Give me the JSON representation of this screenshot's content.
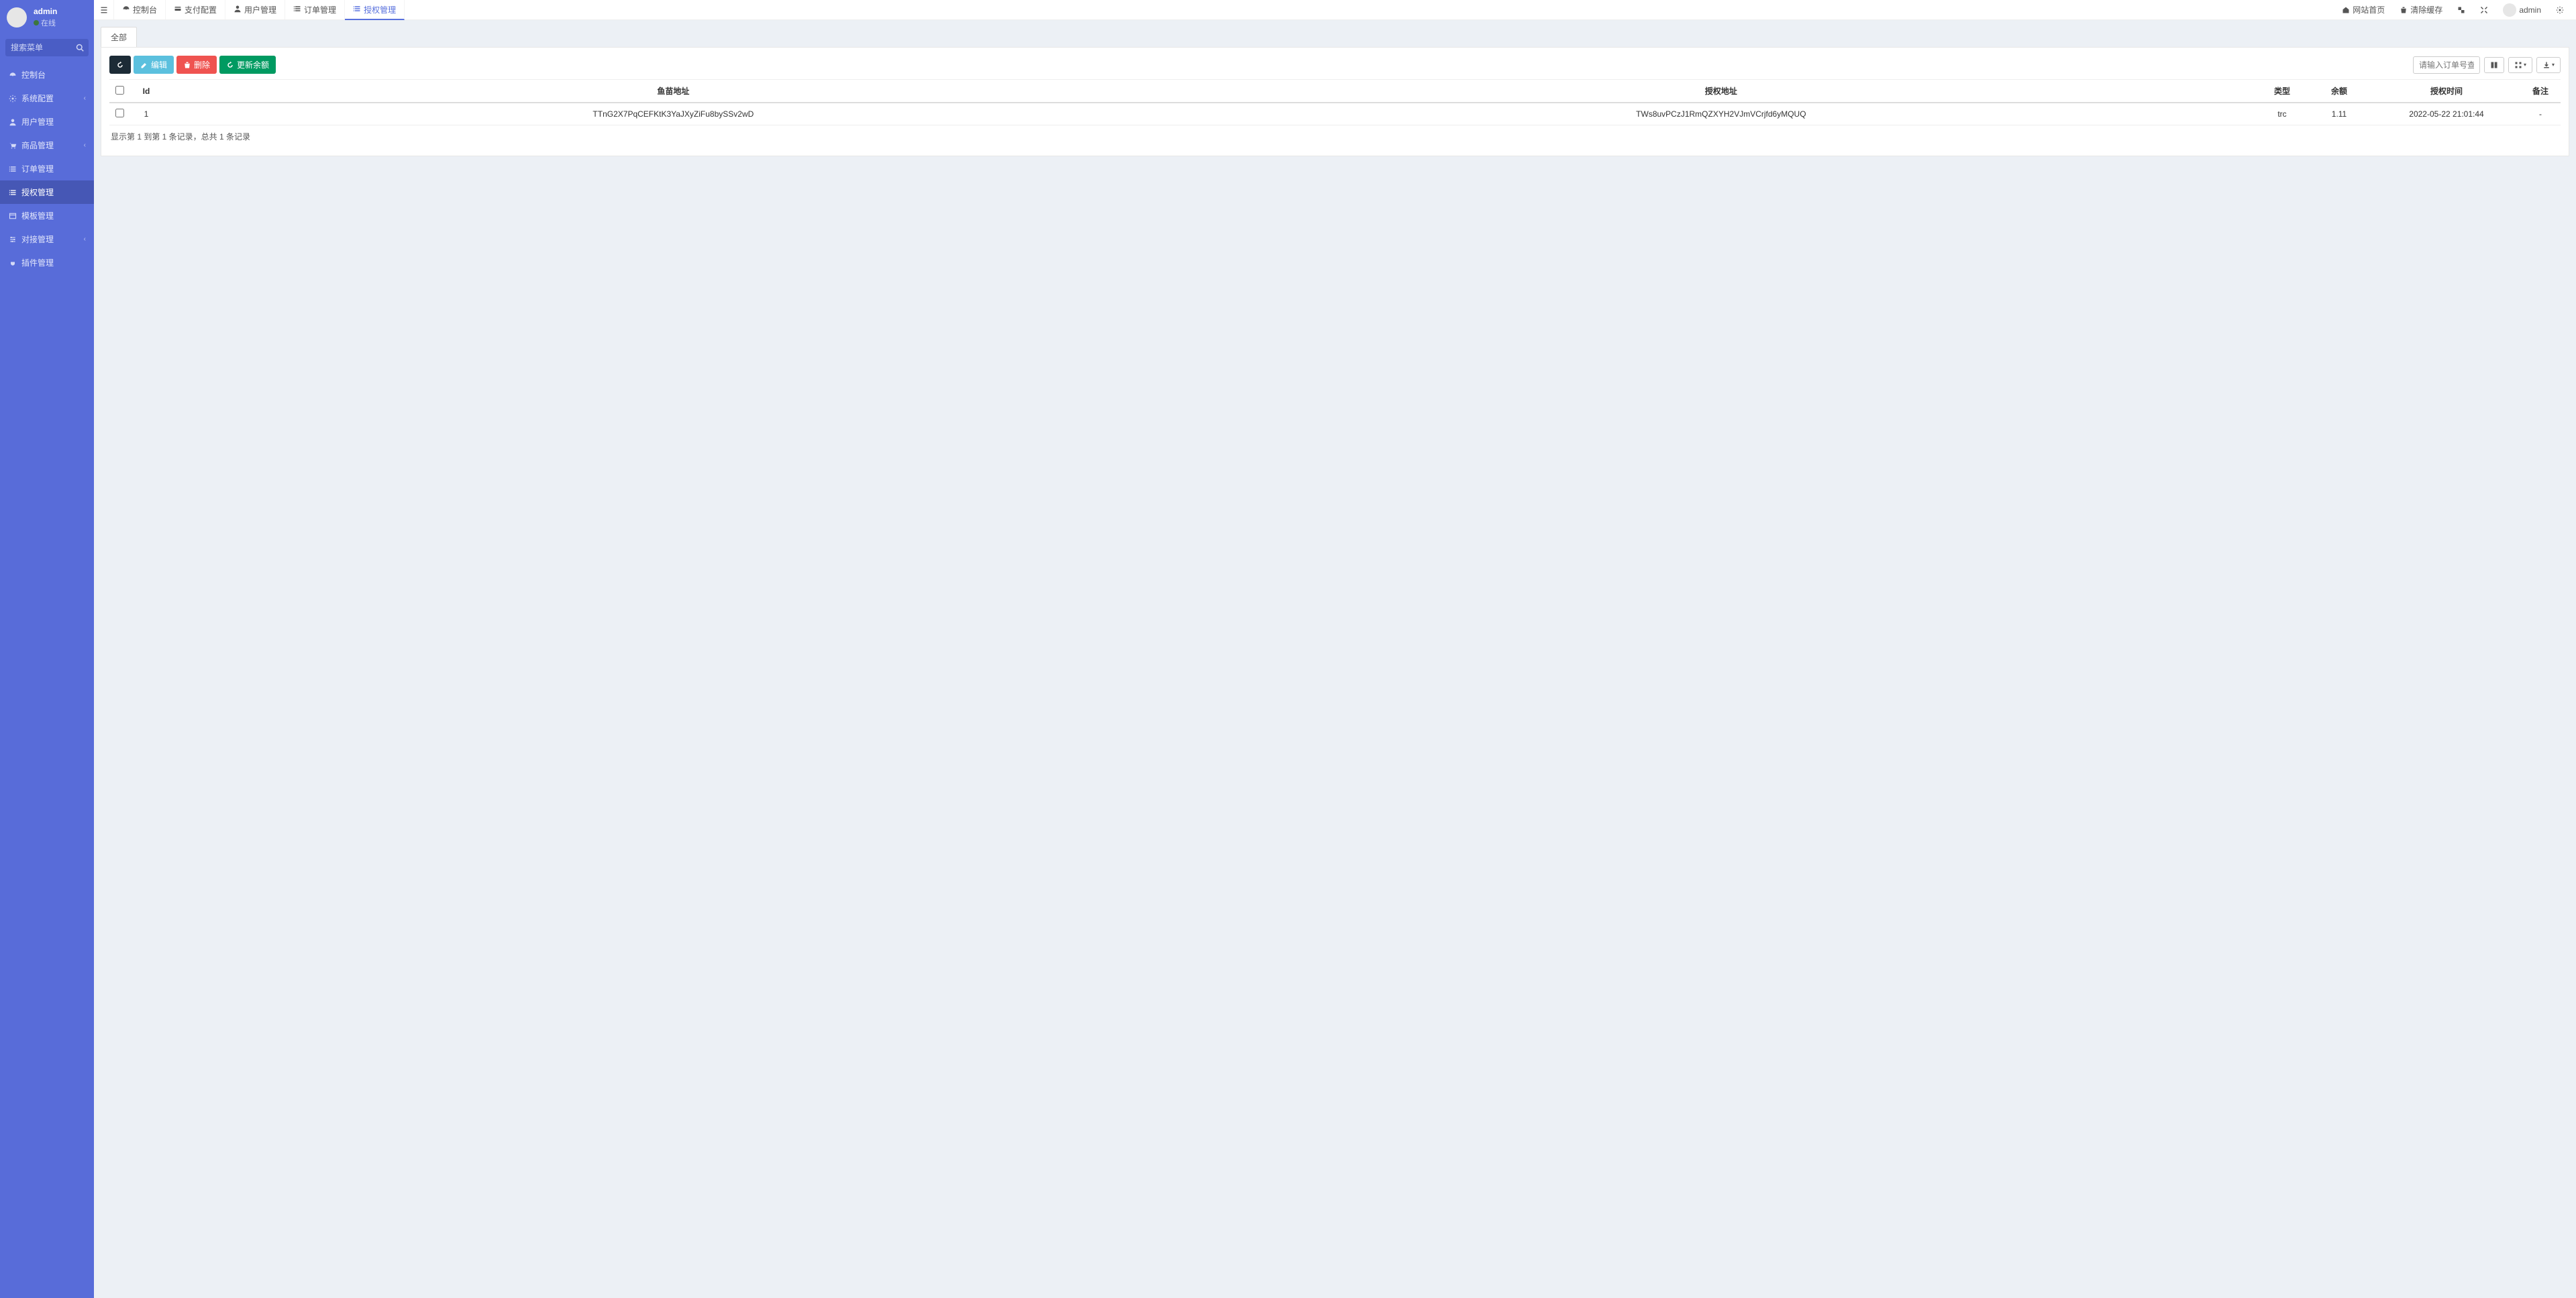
{
  "user": {
    "name": "admin",
    "status": "在线"
  },
  "sidebar": {
    "search_placeholder": "搜索菜单",
    "items": [
      {
        "icon": "dashboard",
        "label": "控制台",
        "chev": false
      },
      {
        "icon": "cog",
        "label": "系统配置",
        "chev": true
      },
      {
        "icon": "user",
        "label": "用户管理",
        "chev": false
      },
      {
        "icon": "cart",
        "label": "商品管理",
        "chev": true
      },
      {
        "icon": "list",
        "label": "订单管理",
        "chev": false
      },
      {
        "icon": "list",
        "label": "授权管理",
        "chev": false,
        "active": true
      },
      {
        "icon": "window",
        "label": "模板管理",
        "chev": false
      },
      {
        "icon": "sliders",
        "label": "对接管理",
        "chev": true
      },
      {
        "icon": "plug",
        "label": "插件管理",
        "chev": false
      }
    ]
  },
  "topbar": {
    "tabs": [
      {
        "icon": "dashboard",
        "label": "控制台"
      },
      {
        "icon": "credit",
        "label": "支付配置"
      },
      {
        "icon": "user",
        "label": "用户管理"
      },
      {
        "icon": "list",
        "label": "订单管理"
      },
      {
        "icon": "list",
        "label": "授权管理",
        "active": true
      }
    ],
    "right": {
      "home": "网站首页",
      "clear_cache": "清除缓存",
      "username": "admin"
    }
  },
  "content": {
    "tab_label": "全部",
    "toolbar": {
      "edit": "编辑",
      "delete": "删除",
      "update_balance": "更新余额",
      "search_placeholder": "请输入订单号查询"
    },
    "table": {
      "headers": {
        "id": "Id",
        "fry_address": "鱼苗地址",
        "auth_address": "授权地址",
        "type": "类型",
        "balance": "余额",
        "auth_time": "授权时间",
        "remark": "备注"
      },
      "rows": [
        {
          "id": "1",
          "fry_address": "TTnG2X7PqCEFKtK3YaJXyZiFu8bySSv2wD",
          "auth_address": "TWs8uvPCzJ1RmQZXYH2VJmVCrjfd6yMQUQ",
          "type": "trc",
          "balance": "1.11",
          "auth_time": "2022-05-22 21:01:44",
          "remark": "-"
        }
      ]
    },
    "pager": "显示第 1 到第 1 条记录，总共 1 条记录"
  }
}
